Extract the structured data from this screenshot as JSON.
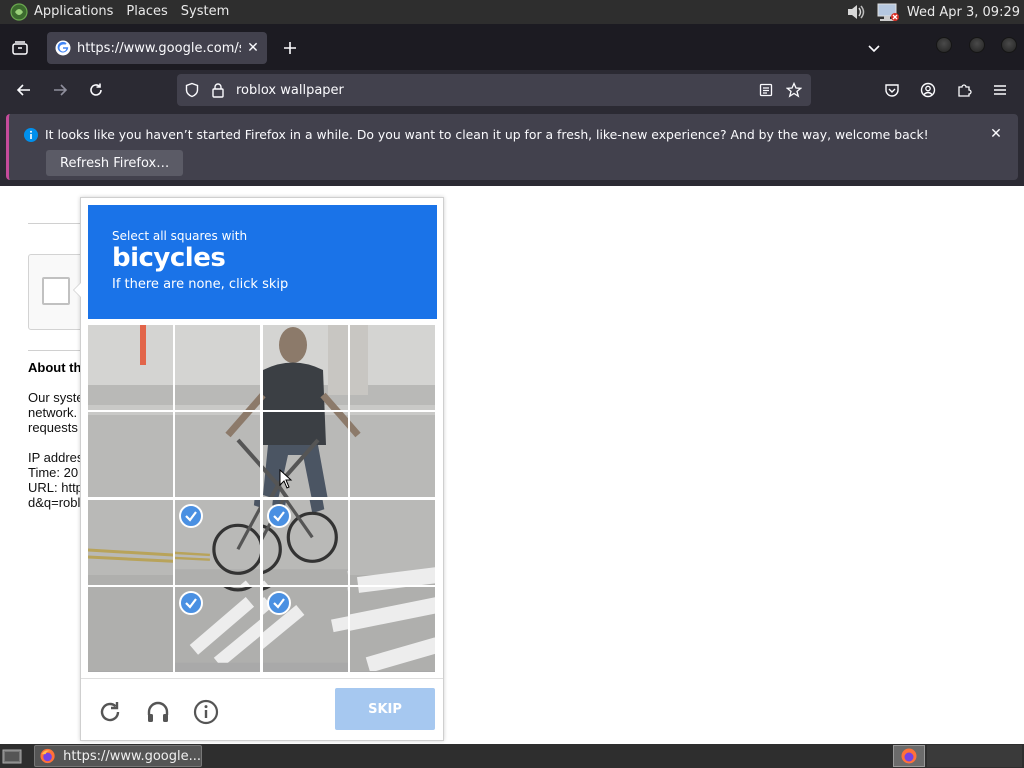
{
  "top_panel": {
    "menus": [
      "Applications",
      "Places",
      "System"
    ],
    "clock": "Wed Apr 3, 09:29",
    "tray_icons": [
      "volume-icon",
      "network-icon"
    ]
  },
  "browser": {
    "tab": {
      "title": "https://www.google.com/sorry",
      "favicon": "google-icon"
    },
    "url": "roblox wallpaper",
    "notification": {
      "text": "It looks like you haven’t started Firefox in a while. Do you want to clean it up for a fresh, like-new experience? And by the way, welcome back!",
      "button": "Refresh Firefox…"
    }
  },
  "page": {
    "about_heading": "About th",
    "lines": [
      "Our syste",
      "network.",
      "requests",
      "",
      "IP addres",
      "Time: 20",
      "URL: http",
      "d&q=robl"
    ]
  },
  "captcha": {
    "instruction": "Select all squares with",
    "target": "bicycles",
    "hint": "If there are none, click skip",
    "selected_tiles": [
      9,
      10,
      13,
      14
    ],
    "skip_label": "SKIP",
    "accent": "#1a73e8"
  },
  "taskbar": {
    "task_label": "https://www.google..."
  }
}
